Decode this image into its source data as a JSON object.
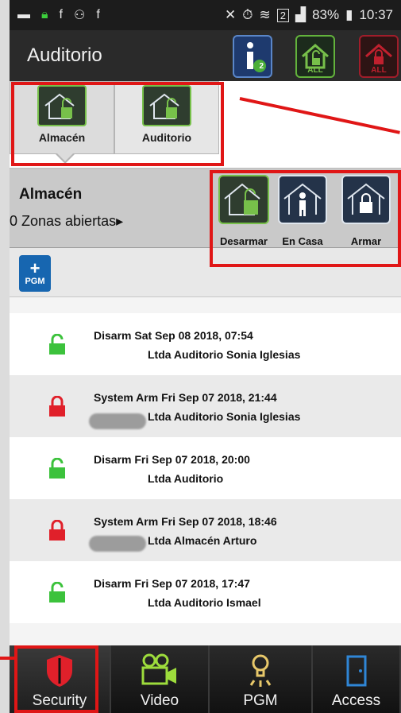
{
  "status_bar": {
    "battery": "83%",
    "time": "10:37",
    "signal_badge": "2"
  },
  "header": {
    "title": "Auditorio",
    "info_badge": "2",
    "all_label_green": "ALL",
    "all_label_red": "ALL"
  },
  "partitions": [
    {
      "label": "Almacén"
    },
    {
      "label": "Auditorio"
    }
  ],
  "panel": {
    "partition_name": "Almacén",
    "zones_text": "0 Zonas abiertas",
    "commands": [
      {
        "label": "Desarmar"
      },
      {
        "label": "En Casa"
      },
      {
        "label": "Armar"
      }
    ]
  },
  "pgm_button": {
    "plus": "+",
    "label": "PGM"
  },
  "events": [
    {
      "state": "disarm",
      "line1": "Disarm Sat Sep 08 2018, 07:54",
      "line2": "Ltda Auditorio Sonia Iglesias"
    },
    {
      "state": "arm",
      "line1": "System Arm Fri Sep 07 2018, 21:44",
      "line2": "Ltda Auditorio Sonia Iglesias"
    },
    {
      "state": "disarm",
      "line1": "Disarm Fri Sep 07 2018, 20:00",
      "line2": "Ltda Auditorio"
    },
    {
      "state": "arm",
      "line1": "System Arm Fri Sep 07 2018, 18:46",
      "line2": "Ltda Almacén Arturo"
    },
    {
      "state": "disarm",
      "line1": "Disarm Fri Sep 07 2018, 17:47",
      "line2": "Ltda Auditorio Ismael"
    }
  ],
  "bottom_nav": [
    {
      "label": "Security",
      "icon": "shield-icon",
      "active": true
    },
    {
      "label": "Video",
      "icon": "video-camera-icon",
      "active": false
    },
    {
      "label": "PGM",
      "icon": "lightbulb-icon",
      "active": false
    },
    {
      "label": "Access",
      "icon": "door-icon",
      "active": false
    }
  ],
  "colors": {
    "disarm_green": "#3cc23c",
    "arm_red": "#e0202a",
    "accent_green": "#77c04a",
    "annotation_red": "#e01616",
    "nav_blue": "#2f86d6"
  }
}
